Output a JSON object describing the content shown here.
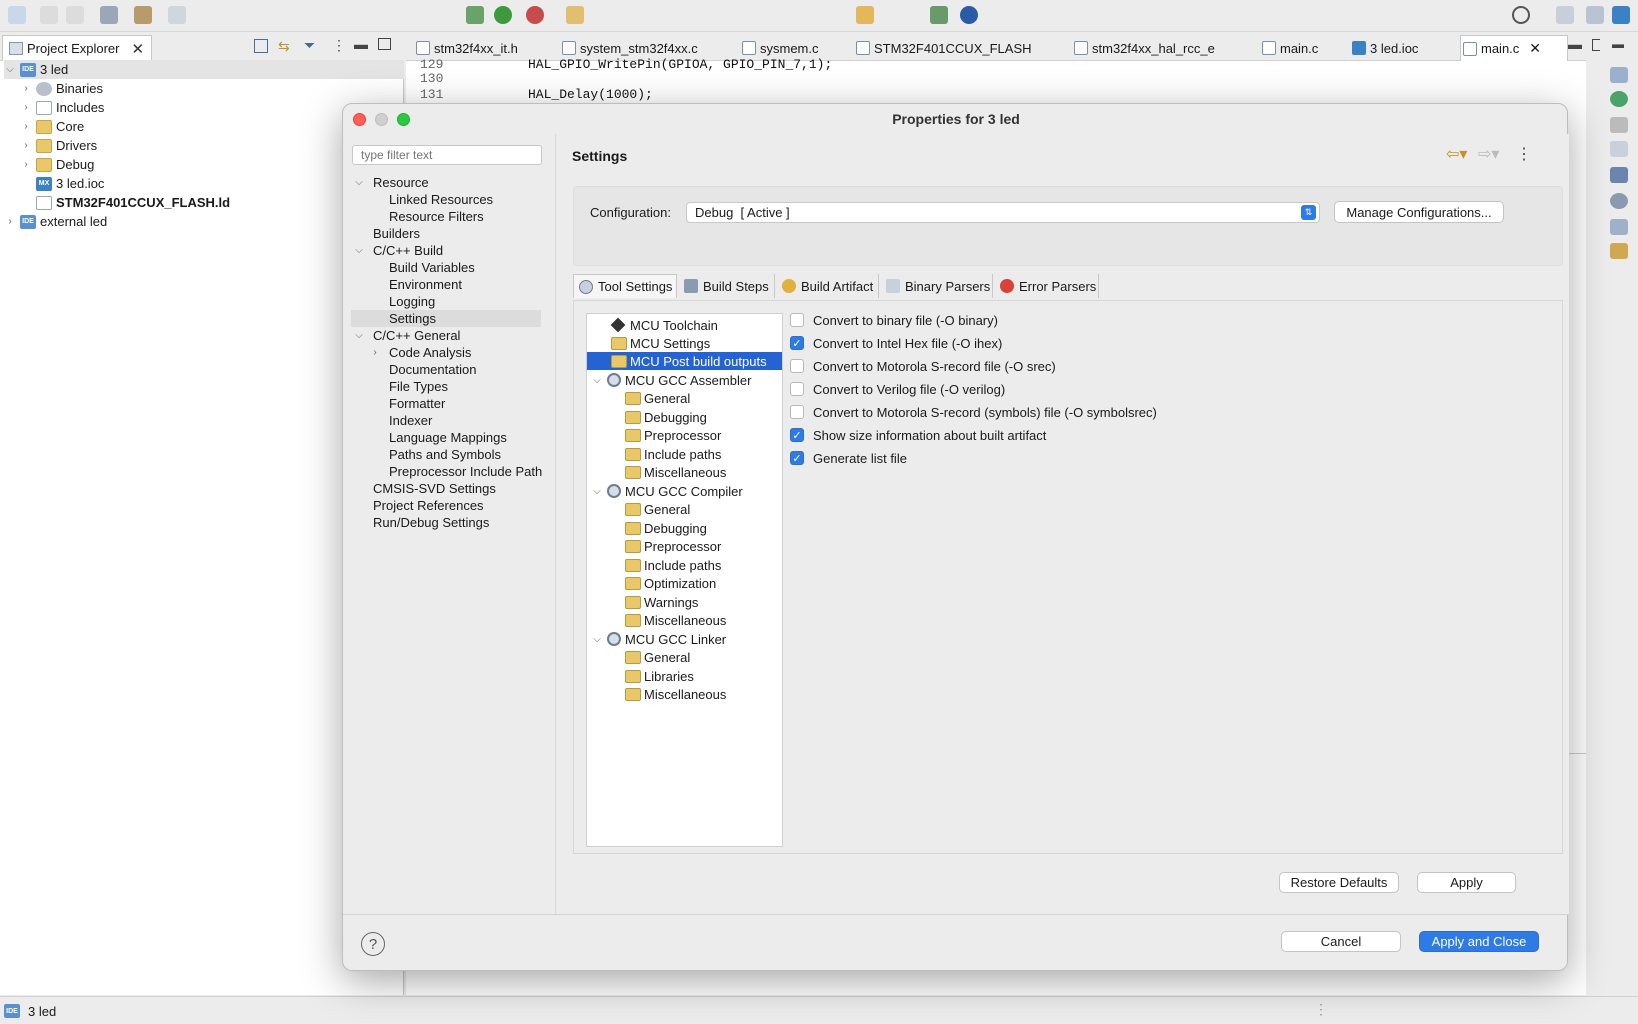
{
  "project_explorer": {
    "title": "Project Explorer",
    "tree": [
      {
        "label": "3 led",
        "icon": "ide-project-icon"
      },
      {
        "label": "Binaries",
        "icon": "binaries-icon"
      },
      {
        "label": "Includes",
        "icon": "includes-icon"
      },
      {
        "label": "Core",
        "icon": "folder-icon"
      },
      {
        "label": "Drivers",
        "icon": "folder-icon"
      },
      {
        "label": "Debug",
        "icon": "folder-icon"
      },
      {
        "label": "3 led.ioc",
        "icon": "mx-file-icon"
      },
      {
        "label": "STM32F401CCUX_FLASH.ld",
        "icon": "linker-file-icon"
      },
      {
        "label": "external led",
        "icon": "ide-project-icon"
      }
    ]
  },
  "editor": {
    "tabs": [
      "stm32f4xx_it.h",
      "system_stm32f4xx.c",
      "sysmem.c",
      "STM32F401CCUX_FLASH",
      "stm32f4xx_hal_rcc_e",
      "main.c",
      "3 led.ioc",
      "main.c"
    ],
    "lines": [
      {
        "num": "129",
        "code": "HAL_GPIO_WritePin(GPIOA, GPIO_PIN_7,1);"
      },
      {
        "num": "130",
        "code": ""
      },
      {
        "num": "131",
        "code": "HAL_Delay(1000);"
      }
    ]
  },
  "dialog": {
    "title": "Properties for 3 led",
    "filter_placeholder": "type filter text",
    "nav": [
      "Resource",
      "Linked Resources",
      "Resource Filters",
      "Builders",
      "C/C++ Build",
      "Build Variables",
      "Environment",
      "Logging",
      "Settings",
      "C/C++ General",
      "Code Analysis",
      "Documentation",
      "File Types",
      "Formatter",
      "Indexer",
      "Language Mappings",
      "Paths and Symbols",
      "Preprocessor Include Path",
      "CMSIS-SVD Settings",
      "Project References",
      "Run/Debug Settings"
    ],
    "page_title": "Settings",
    "configuration_label": "Configuration:",
    "configuration_value": "Debug  [ Active ]",
    "manage_button": "Manage Configurations...",
    "tabs": [
      "Tool Settings",
      "Build Steps",
      "Build Artifact",
      "Binary Parsers",
      "Error Parsers"
    ],
    "tool_tree": [
      "MCU Toolchain",
      "MCU Settings",
      "MCU Post build outputs",
      "MCU GCC Assembler",
      "General",
      "Debugging",
      "Preprocessor",
      "Include paths",
      "Miscellaneous",
      "MCU GCC Compiler",
      "General",
      "Debugging",
      "Preprocessor",
      "Include paths",
      "Optimization",
      "Warnings",
      "Miscellaneous",
      "MCU GCC Linker",
      "General",
      "Libraries",
      "Miscellaneous"
    ],
    "options": [
      {
        "label": "Convert to binary file (-O binary)",
        "checked": false
      },
      {
        "label": "Convert to Intel Hex file (-O ihex)",
        "checked": true
      },
      {
        "label": "Convert to Motorola S-record file (-O srec)",
        "checked": false
      },
      {
        "label": "Convert to Verilog file (-O verilog)",
        "checked": false
      },
      {
        "label": "Convert to Motorola S-record (symbols) file (-O symbolsrec)",
        "checked": false
      },
      {
        "label": "Show size information about built artifact",
        "checked": true
      },
      {
        "label": "Generate list file",
        "checked": true
      }
    ],
    "restore_defaults": "Restore Defaults",
    "apply": "Apply",
    "cancel": "Cancel",
    "apply_and_close": "Apply and Close",
    "help_glyph": "?"
  },
  "status": {
    "project": "3 led"
  },
  "colors": {
    "accent": "#2f7be5",
    "selection": "#2463d1"
  }
}
